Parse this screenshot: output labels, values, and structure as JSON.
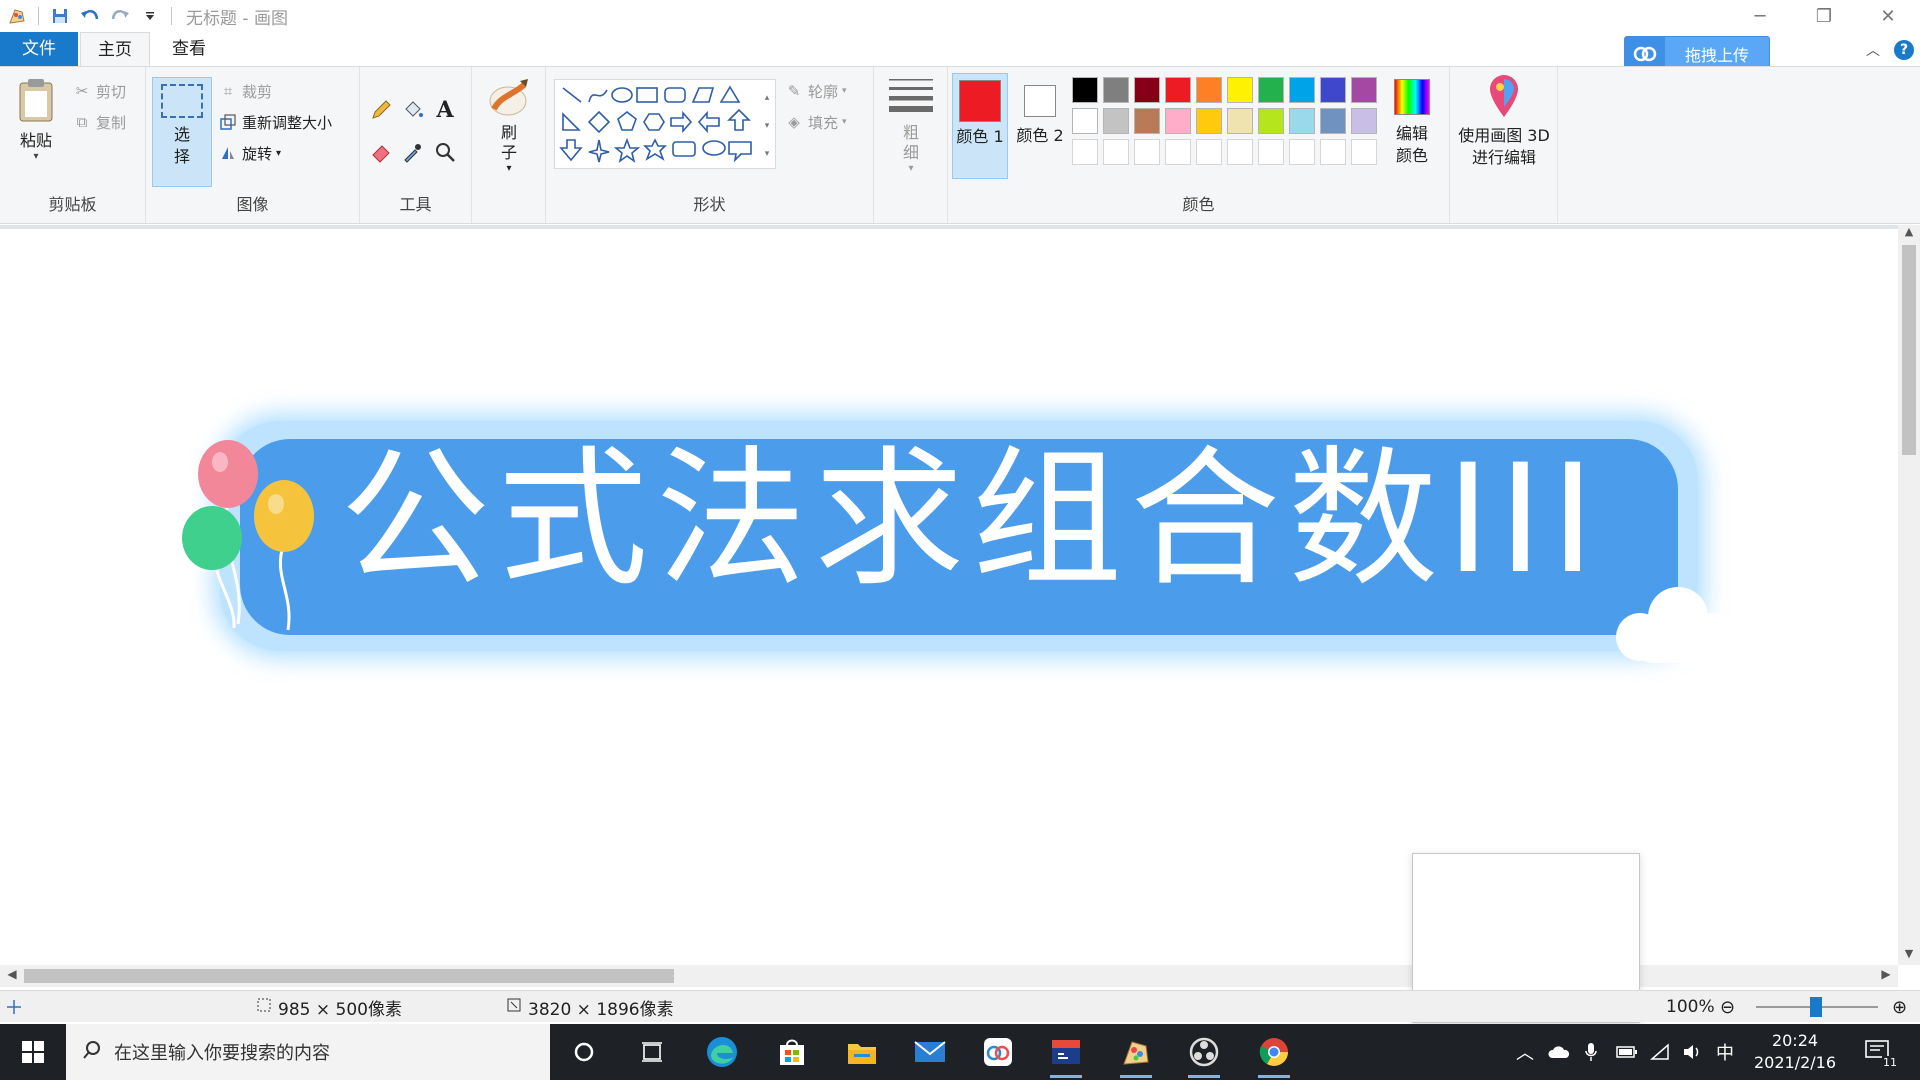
{
  "window": {
    "title": "无标题 - 画图",
    "minimize": "─",
    "restore": "❐",
    "close": "✕"
  },
  "tabs": {
    "file": "文件",
    "home": "主页",
    "view": "查看"
  },
  "upload_button": "拖拽上传",
  "help": "?",
  "ribbon": {
    "clipboard": {
      "paste": "粘贴",
      "cut": "剪切",
      "copy": "复制",
      "label": "剪贴板"
    },
    "image": {
      "select": "选择",
      "crop": "裁剪",
      "resize": "重新调整大小",
      "rotate": "旋转",
      "label": "图像"
    },
    "tools": {
      "label": "工具",
      "text_glyph": "A"
    },
    "brushes": {
      "label": "刷子"
    },
    "shapes": {
      "label": "形状",
      "outline": "轮廓",
      "fill": "填充"
    },
    "size": {
      "label": "粗细"
    },
    "colors": {
      "color1": "颜色 1",
      "color2": "颜色 2",
      "color1_value": "#ed1c24",
      "color2_value": "#ffffff",
      "edit": "编辑颜色",
      "label": "颜色",
      "palette_row1": [
        "#000000",
        "#7f7f7f",
        "#880015",
        "#ed1c24",
        "#ff7f27",
        "#fff200",
        "#22b14c",
        "#00a2e8",
        "#3f48cc",
        "#a349a4"
      ],
      "palette_row2": [
        "#ffffff",
        "#c3c3c3",
        "#b97a57",
        "#ffaec9",
        "#ffc90e",
        "#efe4b0",
        "#b5e61d",
        "#99d9ea",
        "#7092be",
        "#c8bfe7"
      ]
    },
    "paint3d": "使用画图 3D 进行编辑"
  },
  "canvas": {
    "banner_text": "公式法求组合数III"
  },
  "status": {
    "selection_size": "985 × 500像素",
    "image_size": "3820 × 1896像素",
    "zoom": "100%"
  },
  "taskbar": {
    "search_placeholder": "在这里输入你要搜索的内容",
    "ime": "中",
    "time": "20:24",
    "date": "2021/2/16",
    "notifications": "11"
  }
}
